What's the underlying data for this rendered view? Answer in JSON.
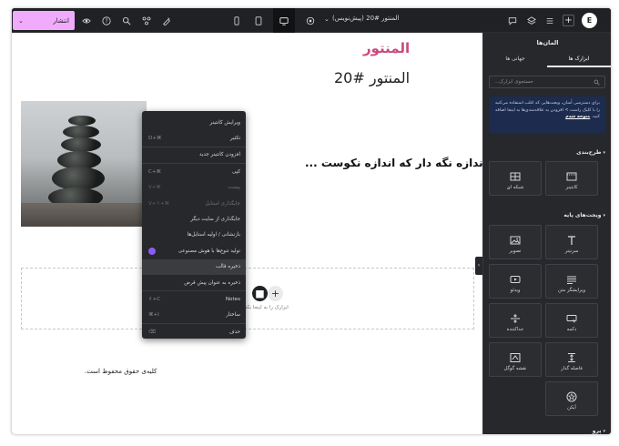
{
  "topbar": {
    "publish_label": "انتشار",
    "publish_chevron": "⌄",
    "doc_title": "المنتور #20 (پیش‌نویس)",
    "doc_chevron": "⌄",
    "add_label": "+",
    "logo_label": "E"
  },
  "canvas": {
    "heading_pink": "المنتور",
    "heading_main": "المنتور #20",
    "subheading": "اندازه نگه دار که اندازه نکوست ...",
    "drop_zone_text": "ابزارک را به اینجا بکشید",
    "drop_zone_plus": "+",
    "footer_text": "کلیه‌ی حقوق محفوظ است."
  },
  "context_menu": {
    "items": [
      {
        "label": "ویرایش کانتینر",
        "shortcut": "",
        "disabled": false
      },
      {
        "label": "تکثیر",
        "shortcut": "D+⌘",
        "disabled": false
      },
      {
        "label": "افزودن کانتینر جدید",
        "shortcut": "",
        "disabled": false
      },
      {
        "label": "کپی",
        "shortcut": "C+⌘",
        "disabled": false
      },
      {
        "label": "پیست",
        "shortcut": "V+⌘",
        "disabled": true
      },
      {
        "label": "جایگذاری استایل",
        "shortcut": "V+⇧+⌘",
        "disabled": true
      },
      {
        "label": "جایگذاری از سایت دیگر",
        "shortcut": "",
        "disabled": false
      },
      {
        "label": "بازنشانی / اولیه استایل‌ها",
        "shortcut": "",
        "disabled": false
      },
      {
        "label": "تولید تنوع‌ها با هوش مصنوعی",
        "shortcut": "",
        "disabled": false
      },
      {
        "label": "ذخیره قالب",
        "shortcut": "",
        "disabled": false
      },
      {
        "label": "ذخیره به عنوان پیش قرض",
        "shortcut": "",
        "disabled": false
      },
      {
        "label": "Notes",
        "shortcut": "⇧+C",
        "disabled": false
      },
      {
        "label": "ساختار",
        "shortcut": "⌘+I",
        "disabled": false
      },
      {
        "label": "حذف",
        "shortcut": "⌫",
        "disabled": false
      }
    ]
  },
  "panel": {
    "title": "المان‌ها",
    "tabs": [
      {
        "label": "ابزارک ها",
        "active": true
      },
      {
        "label": "جهانی ها",
        "active": false
      }
    ],
    "search_placeholder": "جستجوی ابزارک...",
    "promo_text": "برای دسترسی آسان، ویجت‌هایی که اغلب استفاده می‌کنید را با کلیک راست > افزودن به علاقه‌مندی‌ها به اینجا اضافه کنید.",
    "promo_link": "متوجه شدم",
    "sections": [
      {
        "title": "طرح‌بندی",
        "caret": "▾"
      },
      {
        "title": "ویجت‌های پایه",
        "caret": "▾"
      },
      {
        "title": "پرو",
        "caret": "▾"
      }
    ],
    "layout_tiles": [
      {
        "label": "کانتینر",
        "icon": "container-icon"
      },
      {
        "label": "شبکه ای",
        "icon": "grid-icon"
      }
    ],
    "basic_tiles": [
      {
        "label": "سرتیتر",
        "icon": "heading-icon"
      },
      {
        "label": "تصویر",
        "icon": "image-icon"
      },
      {
        "label": "ویرایشگر متن",
        "icon": "text-editor-icon"
      },
      {
        "label": "ویدئو",
        "icon": "video-icon"
      },
      {
        "label": "دکمه",
        "icon": "button-icon"
      },
      {
        "label": "جداکننده",
        "icon": "divider-icon"
      },
      {
        "label": "فاصله گذار",
        "icon": "spacer-icon"
      },
      {
        "label": "نقشه گوگل",
        "icon": "google-map-icon"
      },
      {
        "label": "آیکن",
        "icon": "star-icon"
      }
    ],
    "collapse_label": "‹"
  }
}
